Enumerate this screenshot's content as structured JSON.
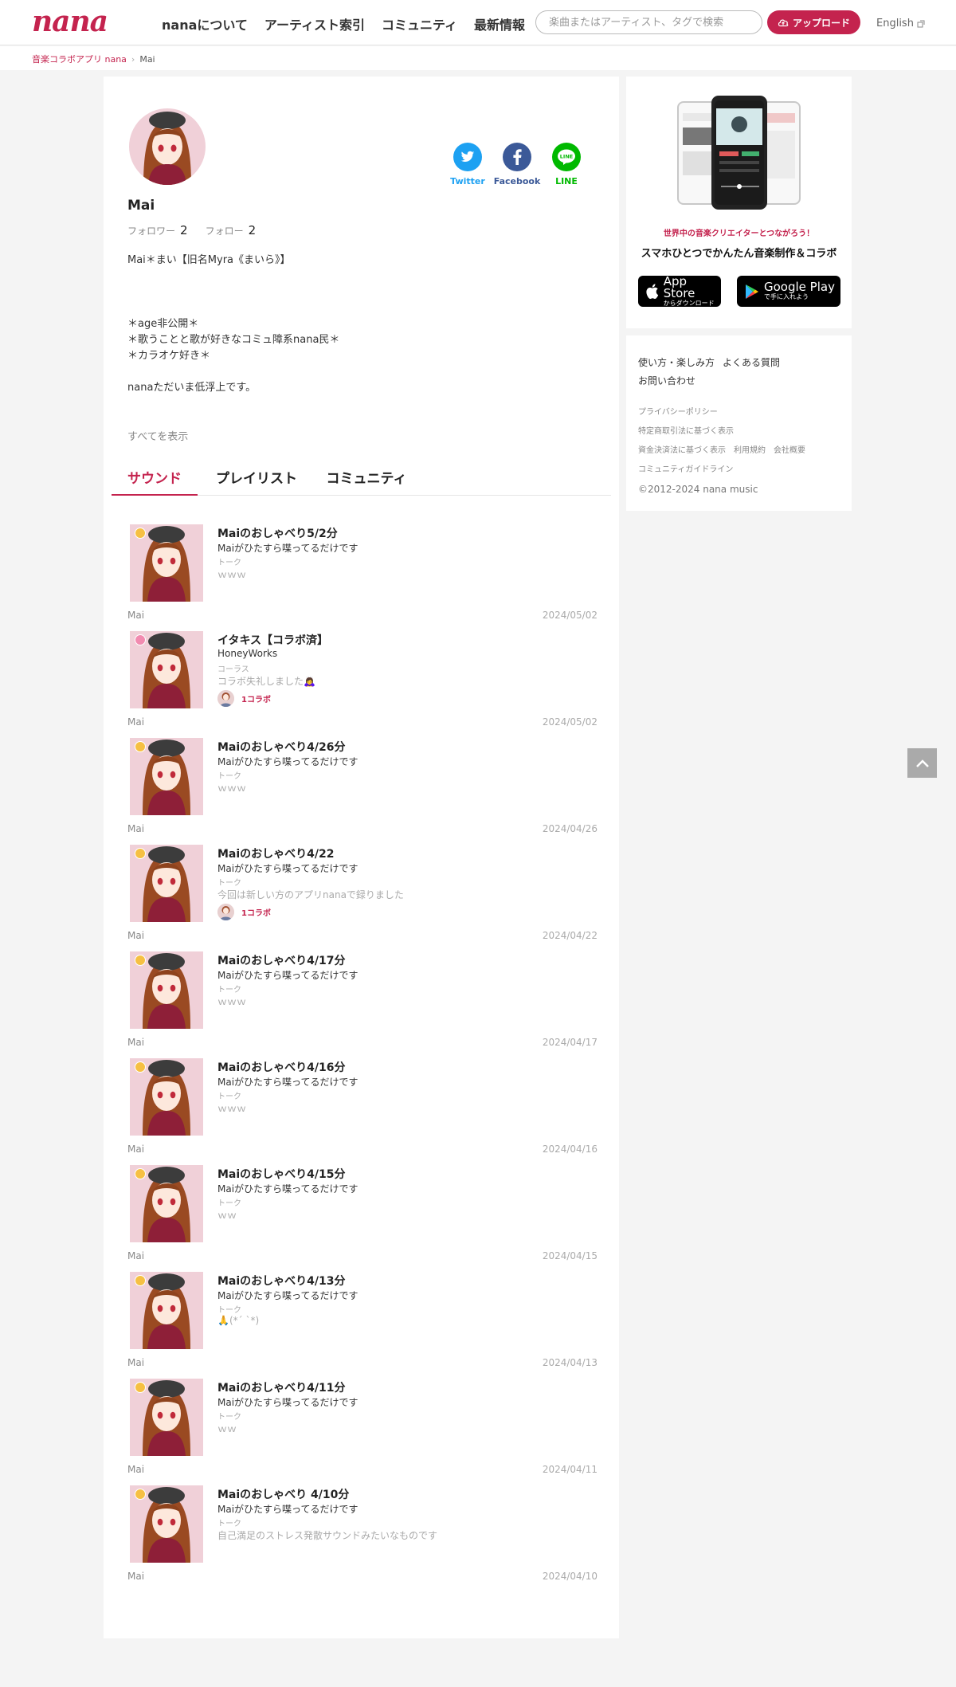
{
  "header": {
    "logo": "nana",
    "nav": [
      "nanaについて",
      "アーティスト索引",
      "コミュニティ",
      "最新情報"
    ],
    "search_placeholder": "楽曲またはアーティスト、タグで検索",
    "upload_label": "アップロード",
    "language": "English"
  },
  "breadcrumb": {
    "home": "音楽コラボアプリ nana",
    "current": "Mai"
  },
  "profile": {
    "name": "Mai",
    "followers_label": "フォロワー",
    "followers_count": "2",
    "following_label": "フォロー",
    "following_count": "2",
    "bio": "Mai＊まい【旧名Myra《まいら》】\n\n\n\n＊age非公開＊\n＊歌うことと歌が好きなコミュ障系nana民＊\n＊カラオケ好き＊\n\nnanaただいま低浮上です。",
    "show_all": "すべてを表示",
    "share": [
      {
        "label": "Twitter",
        "icon": "twitter-icon",
        "color": "#1da1f2"
      },
      {
        "label": "Facebook",
        "icon": "facebook-icon",
        "color": "#3b5998"
      },
      {
        "label": "LINE",
        "icon": "line-icon",
        "color": "#00b900"
      }
    ]
  },
  "tabs": [
    "サウンド",
    "プレイリスト",
    "コミュニティ"
  ],
  "sounds": [
    {
      "title": "Maiのおしゃべり5/2分",
      "artist": "Maiがひたすら喋ってるだけです",
      "category": "トーク",
      "caption": "ｗｗｗ",
      "collab": "",
      "user": "Mai",
      "date": "2024/05/02",
      "badge": "talk"
    },
    {
      "title": "イタキス【コラボ済】",
      "artist": "HoneyWorks",
      "category": "コーラス",
      "caption": "コラボ失礼しました🙇‍♀",
      "collab": "1コラボ",
      "user": "Mai",
      "date": "2024/05/02",
      "badge": "chorus"
    },
    {
      "title": "Maiのおしゃべり4/26分",
      "artist": "Maiがひたすら喋ってるだけです",
      "category": "トーク",
      "caption": "ｗｗｗ",
      "collab": "",
      "user": "Mai",
      "date": "2024/04/26",
      "badge": "talk"
    },
    {
      "title": "Maiのおしゃべり4/22",
      "artist": "Maiがひたすら喋ってるだけです",
      "category": "トーク",
      "caption": "今回は新しい方のアプリnanaで録りました",
      "collab": "1コラボ",
      "user": "Mai",
      "date": "2024/04/22",
      "badge": "talk"
    },
    {
      "title": "Maiのおしゃべり4/17分",
      "artist": "Maiがひたすら喋ってるだけです",
      "category": "トーク",
      "caption": "ｗｗｗ",
      "collab": "",
      "user": "Mai",
      "date": "2024/04/17",
      "badge": "talk"
    },
    {
      "title": "Maiのおしゃべり4/16分",
      "artist": "Maiがひたすら喋ってるだけです",
      "category": "トーク",
      "caption": "ｗｗｗ",
      "collab": "",
      "user": "Mai",
      "date": "2024/04/16",
      "badge": "talk"
    },
    {
      "title": "Maiのおしゃべり4/15分",
      "artist": "Maiがひたすら喋ってるだけです",
      "category": "トーク",
      "caption": "ｗｗ",
      "collab": "",
      "user": "Mai",
      "date": "2024/04/15",
      "badge": "talk"
    },
    {
      "title": "Maiのおしゃべり4/13分",
      "artist": "Maiがひたすら喋ってるだけです",
      "category": "トーク",
      "caption": "🙏(*´ `*)",
      "collab": "",
      "user": "Mai",
      "date": "2024/04/13",
      "badge": "talk"
    },
    {
      "title": "Maiのおしゃべり4/11分",
      "artist": "Maiがひたすら喋ってるだけです",
      "category": "トーク",
      "caption": "ｗｗ",
      "collab": "",
      "user": "Mai",
      "date": "2024/04/11",
      "badge": "talk"
    },
    {
      "title": "Maiのおしゃべり 4/10分",
      "artist": "Maiがひたすら喋ってるだけです",
      "category": "トーク",
      "caption": "自己満足のストレス発散サウンドみたいなものです",
      "collab": "",
      "user": "Mai",
      "date": "2024/04/10",
      "badge": "talk"
    }
  ],
  "sidebar": {
    "tagline": "世界中の音楽クリエイターとつながろう！",
    "headline": "スマホひとつでかんたん音楽制作＆コラボ",
    "appstore_big": "App Store",
    "appstore_small": "からダウンロード",
    "googleplay_big": "Google Play",
    "googleplay_small": "で手に入れよう",
    "links_main": [
      "使い方・楽しみ方",
      "よくある質問"
    ],
    "contact": "お問い合わせ",
    "privacy": "プライバシーポリシー",
    "tokusho": "特定商取引法に基づく表示",
    "shikin": "資金決済法に基づく表示",
    "terms": "利用規約",
    "company": "会社概要",
    "guideline": "コミュニティガイドライン",
    "copyright": "©2012-2024 nana music"
  },
  "colors": {
    "brand": "#c4234e"
  }
}
